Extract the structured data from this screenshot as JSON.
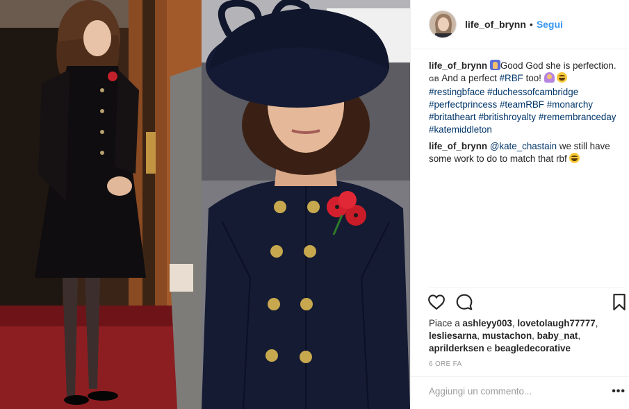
{
  "post": {
    "author": "life_of_brynn",
    "separator": "•",
    "follow_label": "Segui"
  },
  "caption": {
    "user": "life_of_brynn",
    "text1": "Good God she is perfection.",
    "flag": "GB",
    "text2": " And a perfect ",
    "tag_rbf": "#RBF",
    "text3": " too! ",
    "hashtags": [
      "#restingbface",
      "#duchessofcambridge",
      "#perfectprincess",
      "#teamRBF",
      "#monarchy",
      "#britatheart",
      "#britishroyalty",
      "#remembranceday",
      "#katemiddleton"
    ]
  },
  "comment": {
    "user": "life_of_brynn",
    "mention": "@kate_chastain",
    "text": " we still have some work to do to match that rbf "
  },
  "emojis": {
    "pray": "pray-emoji",
    "laugh": "laughing-emoji",
    "person": "person-emoji"
  },
  "likes": {
    "prefix": "Piace a ",
    "names": [
      "ashleyy003",
      "lovetolaugh77777",
      "lesliesarna",
      "mustachon",
      "baby_nat",
      "aprilderksen"
    ],
    "connector": " e ",
    "last": "beagledecorative"
  },
  "timestamp": "6 ORE FA",
  "add_comment": {
    "placeholder": "Aggiungi un commento...",
    "more_label": "•••"
  },
  "icons": {
    "like": "heart-icon",
    "comment": "comment-bubble-icon",
    "save": "bookmark-icon",
    "more": "more-options-icon"
  },
  "colors": {
    "link": "#3897f0",
    "hashtag": "#003569",
    "text": "#262626",
    "muted": "#999999",
    "divider": "#efefef"
  }
}
